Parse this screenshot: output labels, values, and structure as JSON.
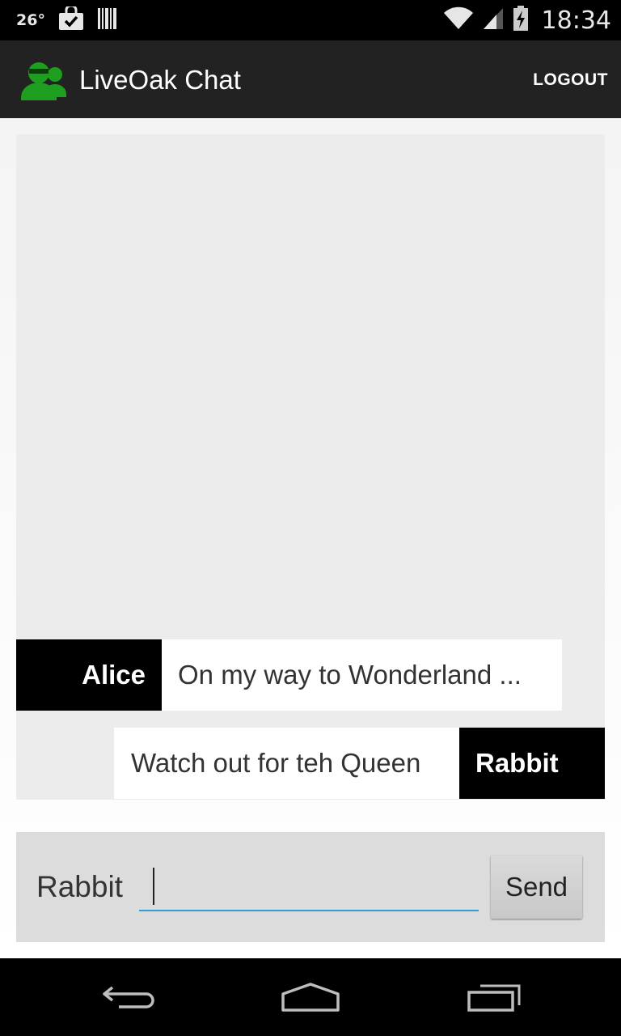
{
  "status_bar": {
    "temperature": "26°",
    "time": "18:34"
  },
  "action_bar": {
    "title": "LiveOak Chat",
    "logout_label": "LOGOUT",
    "logo_color": "#1e9e1e"
  },
  "messages": [
    {
      "sender": "Alice",
      "text": "On my way to Wonderland ..."
    },
    {
      "sender": "Rabbit",
      "text": "Watch out for teh Queen"
    }
  ],
  "composer": {
    "username": "Rabbit",
    "input_value": "",
    "send_label": "Send",
    "accent_color": "#2d9fd8"
  },
  "nav_bar": {
    "icons": [
      "back-icon",
      "home-icon",
      "recent-apps-icon"
    ]
  }
}
